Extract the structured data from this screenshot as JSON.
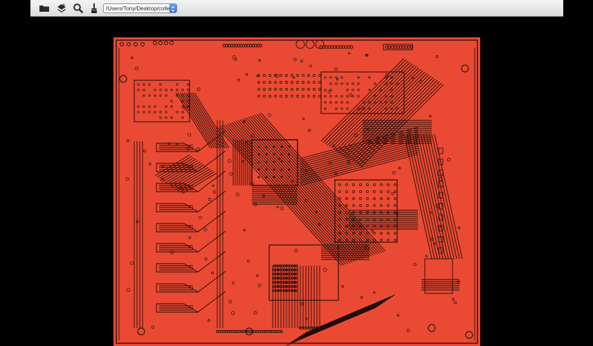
{
  "toolbar": {
    "icons": [
      "folder-icon",
      "layers-icon",
      "magnifier-icon",
      "brush-icon"
    ],
    "path_value": "/Users/Tony/Desktop/collection"
  },
  "viewer": {
    "board_color": "#ea4a33",
    "trace_color": "#1a0c08",
    "background_color": "#000000"
  }
}
